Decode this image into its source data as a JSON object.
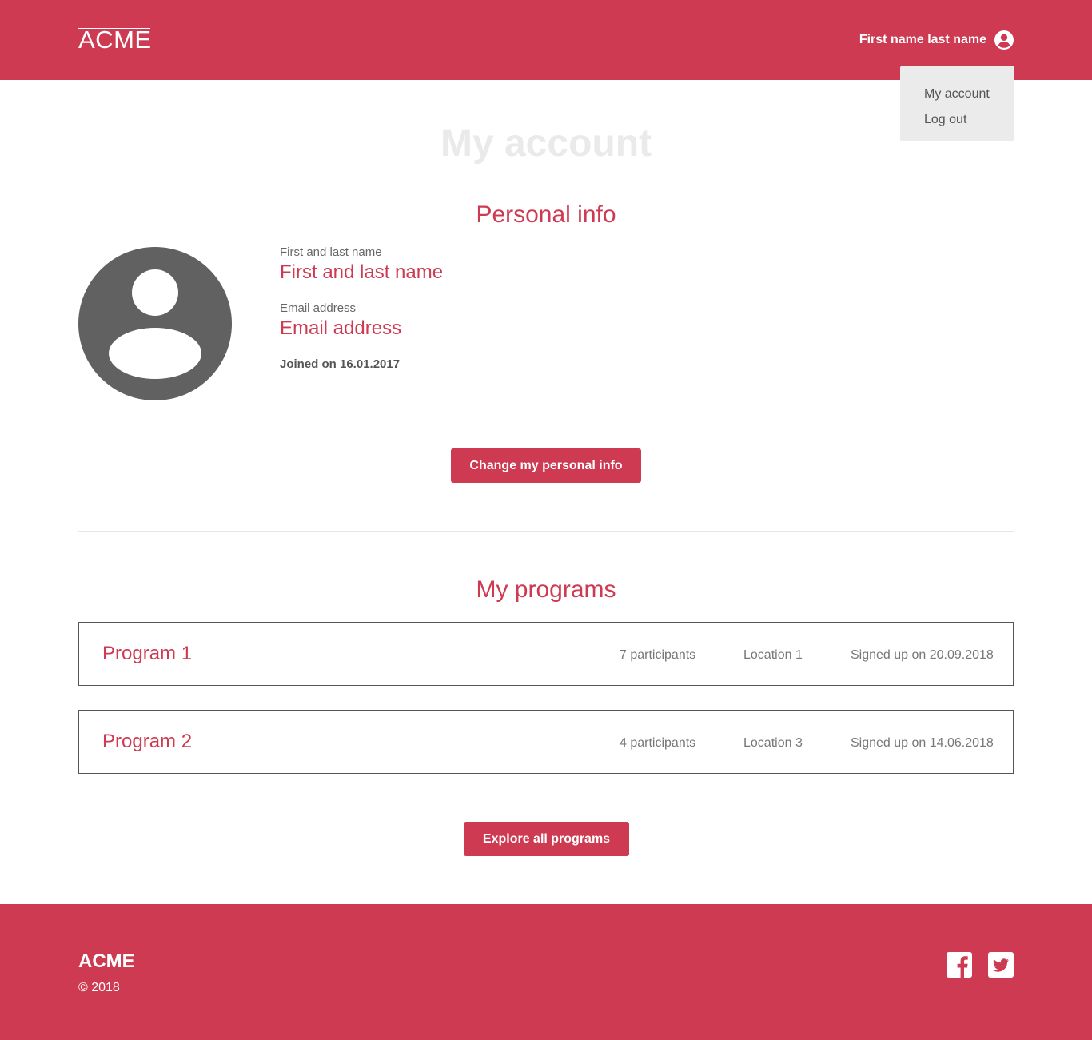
{
  "header": {
    "logo": "ACME",
    "user_name": "First name last name",
    "user_icon": "account-circle-icon"
  },
  "dropdown": {
    "items": [
      {
        "label": "My account"
      },
      {
        "label": "Log out"
      }
    ]
  },
  "page": {
    "title": "My account"
  },
  "personal_info": {
    "title": "Personal info",
    "avatar_icon": "user-avatar-icon",
    "name_label": "First and last name",
    "name_value": "First and last name",
    "email_label": "Email address",
    "email_value": "Email address",
    "joined": "Joined on 16.01.2017",
    "change_button": "Change my personal info"
  },
  "programs": {
    "title": "My programs",
    "items": [
      {
        "name": "Program 1",
        "participants": "7 participants",
        "location": "Location 1",
        "signed_up": "Signed up on 20.09.2018"
      },
      {
        "name": "Program 2",
        "participants": "4 participants",
        "location": "Location 3",
        "signed_up": "Signed up on 14.06.2018"
      }
    ],
    "explore_button": "Explore all programs"
  },
  "footer": {
    "logo": "ACME",
    "copyright": "© 2018",
    "social": [
      "facebook-icon",
      "twitter-icon"
    ]
  },
  "colors": {
    "brand": "#cd3a51",
    "page_title": "#eaeaea",
    "dropdown_bg": "#ebebeb",
    "avatar": "#616161"
  }
}
